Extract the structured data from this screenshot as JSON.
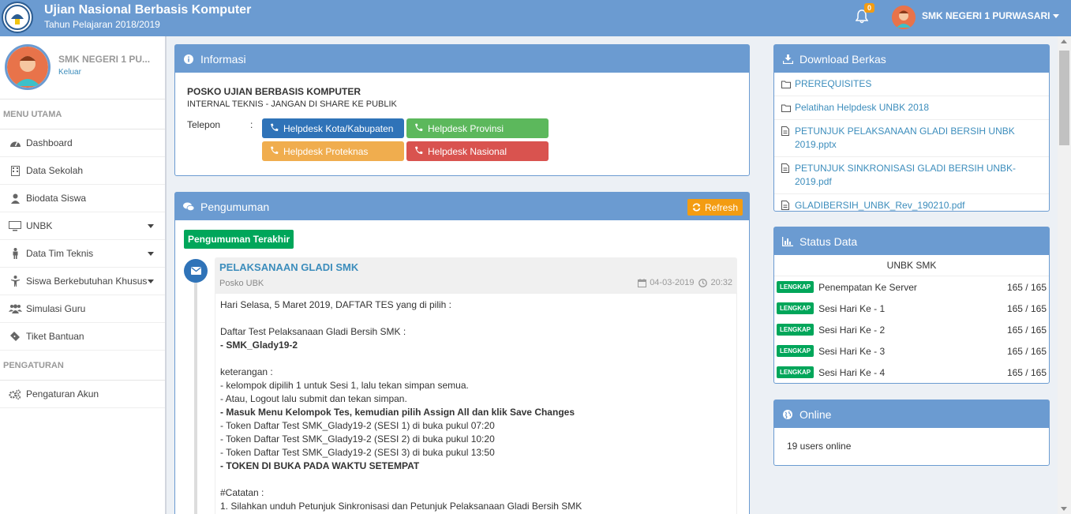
{
  "header": {
    "title": "Ujian Nasional Berbasis Komputer",
    "subtitle": "Tahun Pelajaran 2018/2019",
    "notification_count": "0",
    "user_name": "SMK NEGERI 1 PURWASARI"
  },
  "sidebar": {
    "profile_name": "SMK NEGERI 1 PU...",
    "logout": "Keluar",
    "section_main": "MENU UTAMA",
    "items": [
      {
        "label": "Dashboard",
        "icon": "dashboard-icon"
      },
      {
        "label": "Data Sekolah",
        "icon": "building-icon"
      },
      {
        "label": "Biodata Siswa",
        "icon": "user-icon"
      },
      {
        "label": "UNBK",
        "icon": "monitor-icon"
      },
      {
        "label": "Data Tim Teknis",
        "icon": "male-icon"
      },
      {
        "label": "Siswa Berkebutuhan Khusus",
        "icon": "child-icon"
      },
      {
        "label": "Simulasi Guru",
        "icon": "users-icon"
      },
      {
        "label": "Tiket Bantuan",
        "icon": "ticket-icon"
      }
    ],
    "section_settings": "PENGATURAN",
    "settings_item": "Pengaturan Akun"
  },
  "informasi": {
    "heading": "Informasi",
    "title": "POSKO UJIAN BERBASIS KOMPUTER",
    "note": "INTERNAL TEKNIS - JANGAN DI SHARE KE PUBLIK",
    "telepon_label": "Telepon",
    "colon": ":",
    "buttons": {
      "kota": "Helpdesk Kota/Kabupaten",
      "provinsi": "Helpdesk Provinsi",
      "proteknas": "Helpdesk Proteknas",
      "nasional": "Helpdesk Nasional"
    }
  },
  "pengumuman": {
    "heading": "Pengumuman",
    "refresh": "Refresh",
    "latest_tag": "Pengumuman Terakhir",
    "item": {
      "title": "PELAKSANAAN GLADI SMK",
      "author": "Posko UBK",
      "date": "04-03-2019",
      "time": "20:32",
      "lines": [
        "Hari Selasa, 5 Maret 2019, DAFTAR TES yang di pilih :",
        "",
        "Daftar Test Pelaksanaan Gladi Bersih SMK :",
        "- SMK_Glady19-2",
        "",
        "keterangan :",
        "- kelompok dipilih 1 untuk Sesi 1, lalu tekan simpan semua.",
        "- Atau, Logout lalu submit dan tekan simpan.",
        "- Masuk Menu Kelompok Tes, kemudian pilih Assign All dan klik Save Changes",
        "- Token Daftar Test SMK_Glady19-2 (SESI 1) di buka pukul 07:20",
        "- Token Daftar Test SMK_Glady19-2 (SESI 2) di buka pukul 10:20",
        "- Token Daftar Test SMK_Glady19-2 (SESI 3) di buka pukul 13:50",
        "- TOKEN DI BUKA PADA WAKTU SETEMPAT",
        "",
        "#Catatan :",
        "1. Silahkan unduh Petunjuk Sinkronisasi dan Petunjuk Pelaksanaan Gladi Bersih SMK"
      ]
    }
  },
  "download": {
    "heading": "Download Berkas",
    "items": [
      {
        "label": "PREREQUISITES",
        "type": "folder"
      },
      {
        "label": "Pelatihan Helpdesk UNBK 2018",
        "type": "folder"
      },
      {
        "label": "PETUNJUK PELAKSANAAN GLADI BERSIH UNBK 2019.pptx",
        "type": "file"
      },
      {
        "label": "PETUNJUK SINKRONISASI GLADI BERSIH UNBK-2019.pdf",
        "type": "file"
      },
      {
        "label": "GLADIBERSIH_UNBK_Rev_190210.pdf",
        "type": "file"
      }
    ]
  },
  "status": {
    "heading": "Status Data",
    "subheading": "UNBK SMK",
    "badge": "LENGKAP",
    "rows": [
      {
        "label": "Penempatan Ke Server",
        "value": "165 / 165"
      },
      {
        "label": "Sesi Hari Ke - 1",
        "value": "165 / 165"
      },
      {
        "label": "Sesi Hari Ke - 2",
        "value": "165 / 165"
      },
      {
        "label": "Sesi Hari Ke - 3",
        "value": "165 / 165"
      },
      {
        "label": "Sesi Hari Ke - 4",
        "value": "165 / 165"
      }
    ]
  },
  "online": {
    "heading": "Online",
    "text": "19 users online"
  },
  "colors": {
    "primary": "#6b9bd1",
    "blue_button": "#2f73b8",
    "green": "#5cb85c",
    "orange": "#f0ad4e",
    "red": "#d9534f",
    "lengkap": "#00a65a"
  }
}
